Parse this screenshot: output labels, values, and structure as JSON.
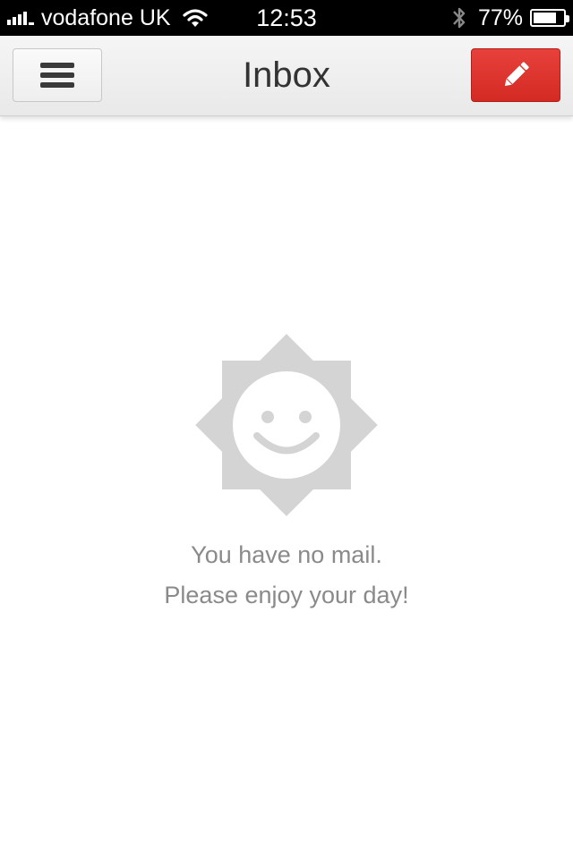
{
  "status_bar": {
    "carrier": "vodafone UK",
    "time": "12:53",
    "battery_percent": "77%",
    "battery_level": 0.77,
    "signal_bars": 4,
    "icons": [
      "signal-icon",
      "wifi-icon",
      "bluetooth-icon",
      "battery-icon"
    ]
  },
  "nav_bar": {
    "title": "Inbox",
    "menu_icon": "menu-icon",
    "compose_icon": "pencil-icon"
  },
  "empty_state": {
    "icon": "smiling-sun-icon",
    "line1": "You have no mail.",
    "line2": "Please enjoy your day!"
  },
  "colors": {
    "accent_red": "#dc3630",
    "empty_icon_gray": "#d4d4d4",
    "empty_text": "#8a8a8a",
    "title_text": "#333333"
  }
}
